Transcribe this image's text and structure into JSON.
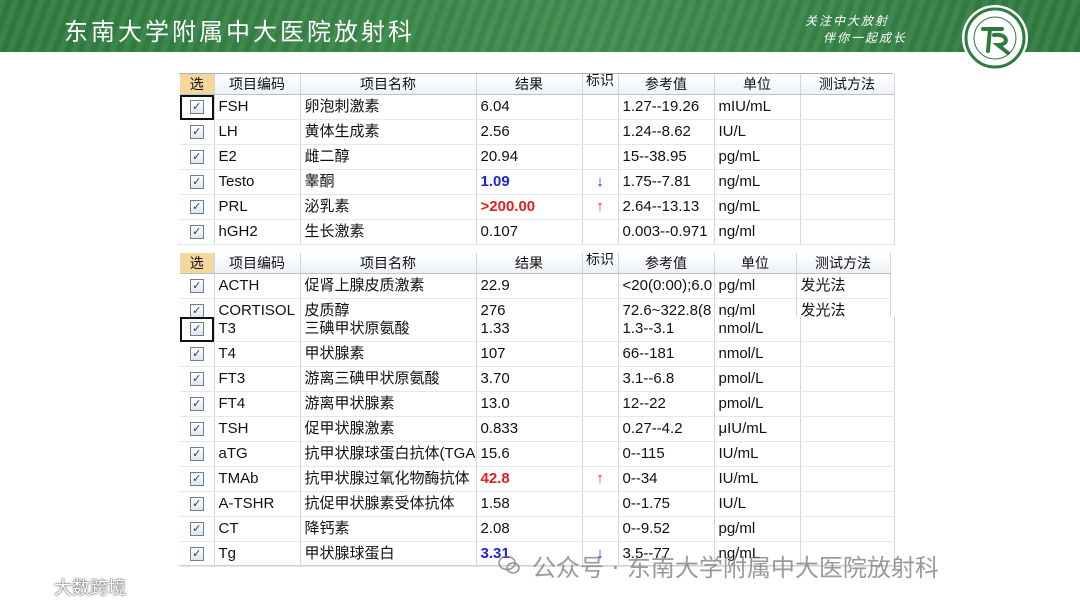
{
  "header": {
    "title": "东南大学附属中大医院放射科",
    "slogan_line1": "关注中大放射",
    "slogan_line2": "伴你一起成长",
    "bg_color": "#3a8a4a"
  },
  "columns": [
    "选",
    "项目编码",
    "项目名称",
    "结果",
    "标识",
    "参考值",
    "单位",
    "测试方法"
  ],
  "table1": {
    "rows": [
      {
        "code": "FSH",
        "name": "卵泡刺激素",
        "result": "6.04",
        "flag": "",
        "ref": "1.27--19.26",
        "unit": "mIU/mL",
        "method": ""
      },
      {
        "code": "LH",
        "name": "黄体生成素",
        "result": "2.56",
        "flag": "",
        "ref": "1.24--8.62",
        "unit": "IU/L",
        "method": ""
      },
      {
        "code": "E2",
        "name": "雌二醇",
        "result": "20.94",
        "flag": "",
        "ref": "15--38.95",
        "unit": "pg/mL",
        "method": ""
      },
      {
        "code": "Testo",
        "name": "睾酮",
        "result": "1.09",
        "flag": "↓",
        "ref": "1.75--7.81",
        "unit": "ng/mL",
        "method": ""
      },
      {
        "code": "PRL",
        "name": "泌乳素",
        "result": ">200.00",
        "flag": "↑",
        "ref": "2.64--13.13",
        "unit": "ng/mL",
        "method": ""
      },
      {
        "code": "hGH2",
        "name": "生长激素",
        "result": "0.107",
        "flag": "",
        "ref": "0.003--0.971",
        "unit": "ng/ml",
        "method": ""
      }
    ]
  },
  "table2": {
    "rows": [
      {
        "code": "ACTH",
        "name": "促肾上腺皮质激素",
        "result": "22.9",
        "flag": "",
        "ref": "<20(0:00);6.0",
        "unit": "pg/ml",
        "method": "发光法"
      },
      {
        "code": "CORTISOL",
        "name": "皮质醇",
        "result": "276",
        "flag": "",
        "ref": "72.6~322.8(8",
        "unit": "ng/ml",
        "method": "发光法"
      }
    ]
  },
  "table3": {
    "rows": [
      {
        "code": "T3",
        "name": "三碘甲状原氨酸",
        "result": "1.33",
        "flag": "",
        "ref": "1.3--3.1",
        "unit": "nmol/L",
        "method": ""
      },
      {
        "code": "T4",
        "name": "甲状腺素",
        "result": "107",
        "flag": "",
        "ref": "66--181",
        "unit": "nmol/L",
        "method": ""
      },
      {
        "code": "FT3",
        "name": "游离三碘甲状原氨酸",
        "result": "3.70",
        "flag": "",
        "ref": "3.1--6.8",
        "unit": "pmol/L",
        "method": ""
      },
      {
        "code": "FT4",
        "name": "游离甲状腺素",
        "result": "13.0",
        "flag": "",
        "ref": "12--22",
        "unit": "pmol/L",
        "method": ""
      },
      {
        "code": "TSH",
        "name": "促甲状腺激素",
        "result": "0.833",
        "flag": "",
        "ref": "0.27--4.2",
        "unit": "μIU/mL",
        "method": ""
      },
      {
        "code": "aTG",
        "name": "抗甲状腺球蛋白抗体(TGA)",
        "result": "15.6",
        "flag": "",
        "ref": "0--115",
        "unit": "IU/mL",
        "method": ""
      },
      {
        "code": "TMAb",
        "name": "抗甲状腺过氧化物酶抗体",
        "result": "42.8",
        "flag": "↑",
        "ref": "0--34",
        "unit": "IU/mL",
        "method": ""
      },
      {
        "code": "A-TSHR",
        "name": "抗促甲状腺素受体抗体",
        "result": "1.58",
        "flag": "",
        "ref": "0--1.75",
        "unit": "IU/L",
        "method": ""
      },
      {
        "code": "CT",
        "name": "降钙素",
        "result": "2.08",
        "flag": "",
        "ref": "0--9.52",
        "unit": "pg/ml",
        "method": ""
      },
      {
        "code": "Tg",
        "name": "甲状腺球蛋白",
        "result": "3.31",
        "flag": "↓",
        "ref": "3.5--77",
        "unit": "ng/mL",
        "method": ""
      }
    ]
  },
  "watermark": "公众号 · 东南大学附属中大医院放射科",
  "brand": "大数跨境"
}
